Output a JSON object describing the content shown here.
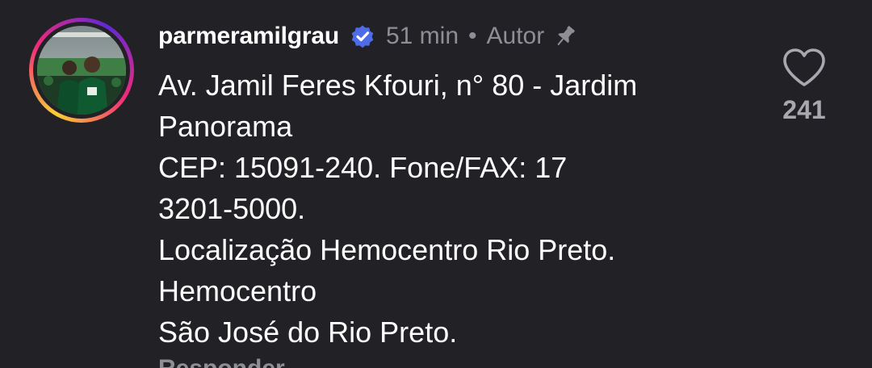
{
  "comment": {
    "username": "parmeramilgrau",
    "verified_icon": "verified-badge-icon",
    "time": "51 min",
    "separator": "•",
    "author_label": "Autor",
    "pin_icon": "pin-icon",
    "text_lines": [
      "Av. Jamil Feres Kfouri, n° 80 - Jardim",
      "Panorama",
      "CEP: 15091-240. Fone/FAX: 17",
      "3201-5000.",
      "Localização Hemocentro Rio Preto.",
      "Hemocentro",
      "São José do Rio Preto."
    ],
    "reply_label": "Responder",
    "like_icon": "heart-icon",
    "like_count": "241"
  },
  "colors": {
    "background": "#212126",
    "text": "#ffffff",
    "secondary_text": "#8e8e95",
    "verified_blue": "#4f6ce8"
  }
}
